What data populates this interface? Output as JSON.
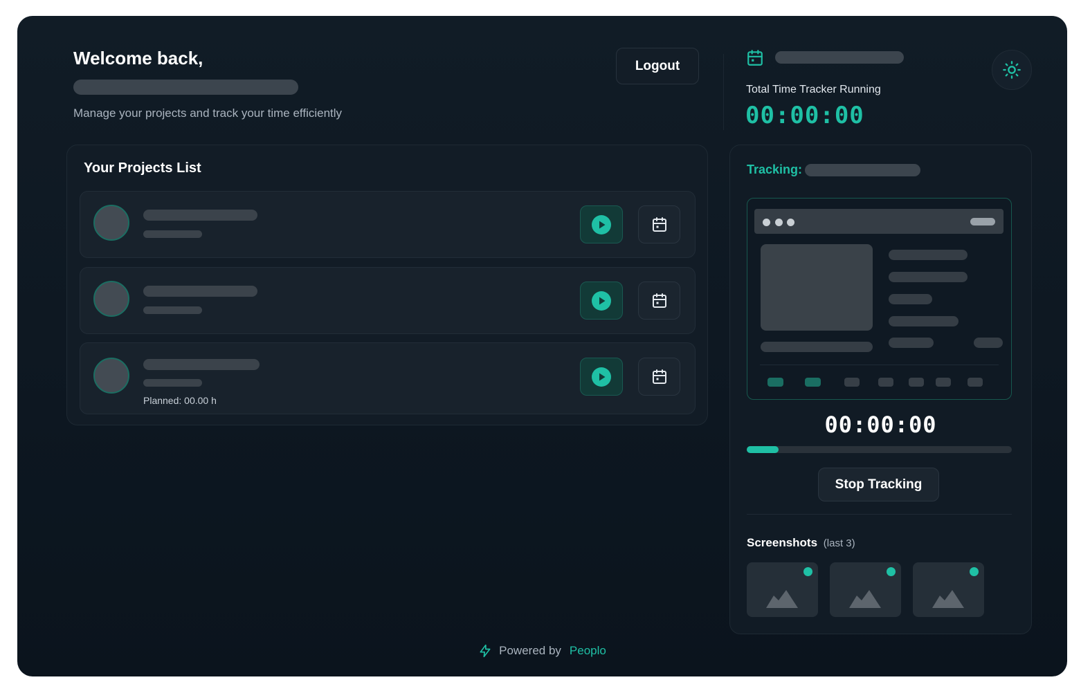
{
  "header": {
    "welcome": "Welcome back,",
    "subtitle": "Manage your projects and track your time efficiently",
    "logout_label": "Logout"
  },
  "timer_summary": {
    "label": "Total Time Tracker Running",
    "time": "00:00:00"
  },
  "projects": {
    "title": "Your Projects List",
    "items": [
      {
        "planned": ""
      },
      {
        "planned": ""
      },
      {
        "planned": "Planned: 00.00 h"
      }
    ]
  },
  "tracking": {
    "label": "Tracking:",
    "time": "00:00:00",
    "progress": 0.12,
    "stop_label": "Stop Tracking"
  },
  "screenshots": {
    "title": "Screenshots",
    "subtitle": "(last 3)",
    "count": 3
  },
  "footer": {
    "powered_by": "Powered by",
    "brand": "Peoplo"
  },
  "icons": {
    "calendar": "calendar-icon",
    "theme": "sun-icon",
    "play": "play-icon",
    "image": "image-icon",
    "bolt": "bolt-icon"
  },
  "colors": {
    "accent": "#1fc0a5",
    "background": "#0f1923",
    "card": "#121c26"
  }
}
